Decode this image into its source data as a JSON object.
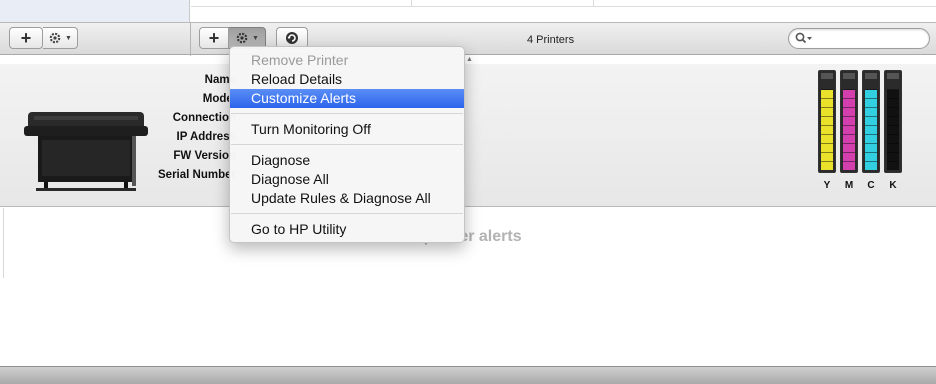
{
  "toolbar": {
    "printer_count": "4 Printers",
    "search_placeholder": ""
  },
  "details": {
    "labels": [
      "Name",
      "Model",
      "Connection",
      "IP Address",
      "FW Version",
      "Serial Number"
    ]
  },
  "ink_levels": [
    {
      "label": "Y",
      "color": "#e9e12a",
      "level": 0.84
    },
    {
      "label": "M",
      "color": "#d43fae",
      "level": 0.84
    },
    {
      "label": "C",
      "color": "#31cfe0",
      "level": 0.84
    },
    {
      "label": "K",
      "color": "#111111",
      "level": 0.84
    }
  ],
  "menu": {
    "items": [
      {
        "label": "Remove Printer",
        "state": "disabled"
      },
      {
        "label": "Reload Details",
        "state": "normal"
      },
      {
        "label": "Customize Alerts",
        "state": "selected"
      },
      {
        "label": "Turn Monitoring Off",
        "state": "normal"
      },
      {
        "label": "Diagnose",
        "state": "normal"
      },
      {
        "label": "Diagnose All",
        "state": "normal"
      },
      {
        "label": "Update Rules & Diagnose All",
        "state": "normal"
      },
      {
        "label": "Go to HP Utility",
        "state": "normal"
      }
    ]
  },
  "main": {
    "empty_message": "No printer alerts"
  },
  "colors": {
    "menu_highlight": "#3b74f0",
    "toolbar_bg": "#e4e4e4"
  },
  "icons": [
    "plus-icon",
    "gear-icon",
    "chevron-down-icon",
    "refresh-icon",
    "search-icon"
  ]
}
